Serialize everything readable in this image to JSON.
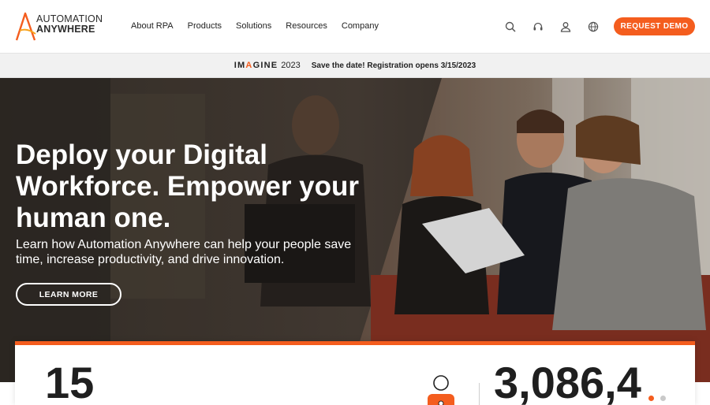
{
  "brand": {
    "line1": "AUTOMATION",
    "line2": "ANYWHERE",
    "accent": "#f45d1e"
  },
  "nav": {
    "items": [
      "About RPA",
      "Products",
      "Solutions",
      "Resources",
      "Company"
    ]
  },
  "header_icons": [
    "search-icon",
    "headset-icon",
    "user-icon",
    "globe-icon"
  ],
  "cta": {
    "label": "REQUEST DEMO"
  },
  "announcement": {
    "event_pre": "IM",
    "event_a": "A",
    "event_post": "GINE",
    "year": "2023",
    "text": "Save the date! Registration opens 3/15/2023"
  },
  "hero": {
    "title": "Deploy your Digital Workforce. Empower your human one.",
    "subtitle": "Learn how Automation Anywhere can help your people save time, increase productivity, and drive innovation.",
    "button": "LEARN MORE"
  },
  "stats": {
    "left_value": "15",
    "right_value": "3,086,4",
    "carousel_dots": 2,
    "active_dot": 0
  }
}
